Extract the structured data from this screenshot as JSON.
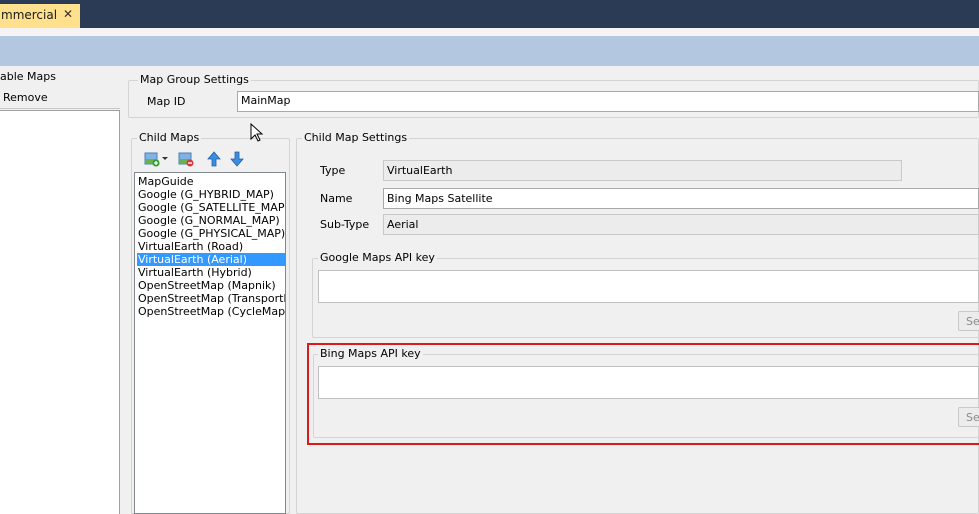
{
  "tab": {
    "title": "mmercial",
    "close": "✕"
  },
  "left_panel": {
    "title": "able Maps",
    "remove_label": "Remove"
  },
  "map_group": {
    "title": "Map Group Settings",
    "map_id_label": "Map ID",
    "map_id_value": "MainMap"
  },
  "child_maps": {
    "title": "Child Maps",
    "items": [
      "MapGuide",
      "Google (G_HYBRID_MAP)",
      "Google (G_SATELLITE_MAP)",
      "Google (G_NORMAL_MAP)",
      "Google (G_PHYSICAL_MAP)",
      "VirtualEarth (Road)",
      "VirtualEarth (Aerial)",
      "VirtualEarth (Hybrid)",
      "OpenStreetMap (Mapnik)",
      "OpenStreetMap (TransportMap)",
      "OpenStreetMap (CycleMap)"
    ],
    "selected_index": 6
  },
  "settings": {
    "title": "Child Map Settings",
    "type_label": "Type",
    "type_value": "VirtualEarth",
    "name_label": "Name",
    "name_value": "Bing Maps Satellite",
    "subtype_label": "Sub-Type",
    "subtype_value": "Aerial",
    "google_title": "Google Maps API key",
    "google_set_label": "Se",
    "bing_title": "Bing Maps API key",
    "bing_set_label": "Se"
  },
  "colors": {
    "highlight": "#d81b1b",
    "selection": "#3399ff",
    "toolbar_band": "#b3c8e0",
    "tab_active": "#ffe08c"
  }
}
